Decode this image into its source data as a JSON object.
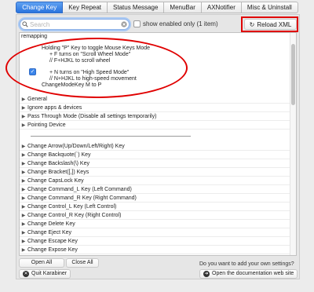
{
  "tabs": [
    {
      "label": "Change Key",
      "active": true
    },
    {
      "label": "Key Repeat",
      "active": false
    },
    {
      "label": "Status Message",
      "active": false
    },
    {
      "label": "MenuBar",
      "active": false
    },
    {
      "label": "AXNotifier",
      "active": false
    },
    {
      "label": "Misc & Uninstall",
      "active": false
    }
  ],
  "toolbar": {
    "search_placeholder": "Search",
    "enabled_only_label": "show enabled only (1 item)",
    "reload_label": "Reload XML"
  },
  "list": {
    "header": "remapping",
    "remap_lines": [
      "Holding \"P\" Key to toggle Mouse Keys Mode",
      "+ F turns on \"Scroll Wheel Mode\"",
      "// F+HJKL to scroll wheel",
      "",
      "+ N turns on \"High Speed Mode\"",
      "// N+HJKL to high-speed movement",
      "ChangeModeKey M to P"
    ],
    "groups": [
      "General",
      "Ignore apps & devices",
      "Pass Through Mode (Disable all settings temporarily)",
      "Pointing Device"
    ],
    "items": [
      "Change Arrow(Up/Down/Left/Right) Key",
      "Change Backquote(`) Key",
      "Change Backslash(\\) Key",
      "Change Bracket([,]) Keys",
      "Change CapsLock Key",
      "Change Command_L Key (Left Command)",
      "Change Command_R Key (Right Command)",
      "Change Control_L Key (Left Control)",
      "Change Control_R Key (Right Control)",
      "Change Delete Key",
      "Change Eject Key",
      "Change Escape Key",
      "Change Expose Key"
    ]
  },
  "footer": {
    "open_all": "Open All",
    "close_all": "Close All",
    "hint": "Do you want to add your own settings?",
    "quit": "Quit Karabiner",
    "open_docs": "Open the documentation web site"
  }
}
